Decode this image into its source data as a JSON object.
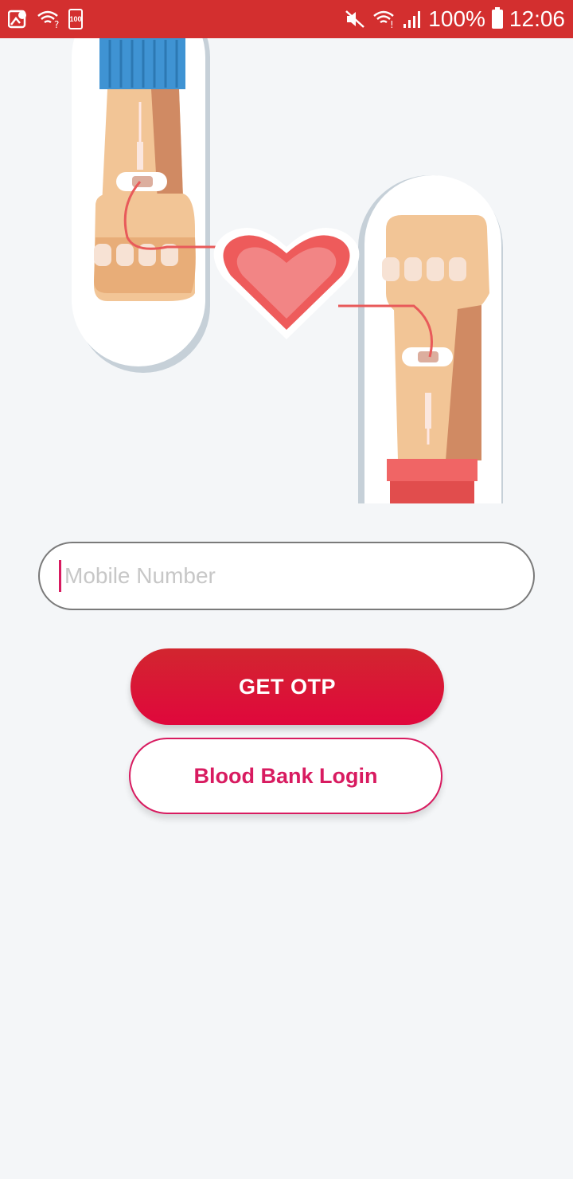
{
  "status_bar": {
    "battery_small_label": "100",
    "battery_percent": "100%",
    "time": "12:06",
    "icons": [
      "gallery-icon",
      "wifi-question-icon",
      "battery-saver-icon",
      "mute-icon",
      "wifi-icon",
      "signal-icon",
      "battery-icon"
    ]
  },
  "illustration": {
    "name": "blood-donation-illustration"
  },
  "login": {
    "mobile_placeholder": "Mobile Number",
    "mobile_value": "",
    "get_otp_label": "GET OTP",
    "blood_bank_label": "Blood Bank Login"
  },
  "colors": {
    "status_bar": "#d32f2f",
    "primary_gradient_top": "#d2262f",
    "primary_gradient_bottom": "#e0073c",
    "accent": "#d81b60",
    "background": "#f4f6f8"
  }
}
